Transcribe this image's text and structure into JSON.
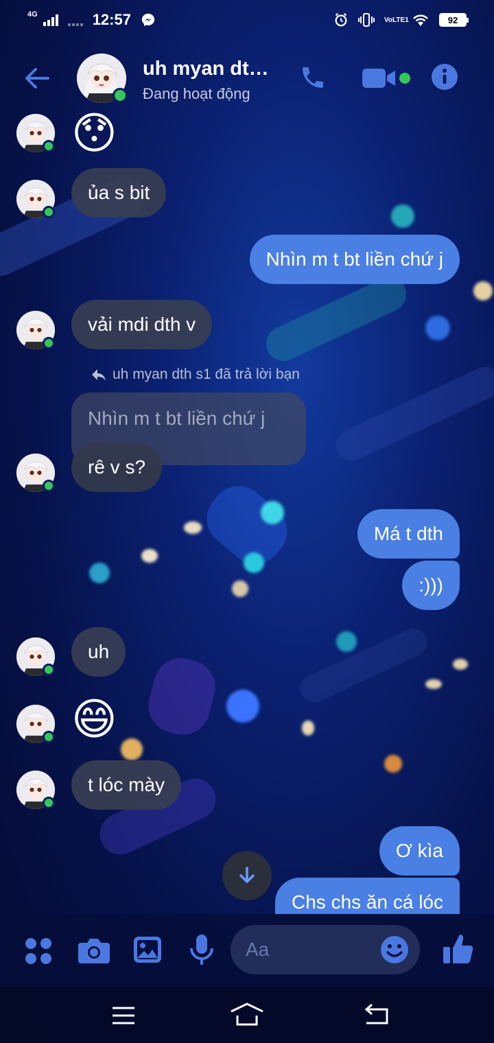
{
  "status_bar": {
    "network": "4G",
    "time": "12:57",
    "lte_label": "VoLTE1",
    "battery": "92"
  },
  "header": {
    "title": "uh myan dt…",
    "subtitle": "Đang hoạt động"
  },
  "messages": [
    {
      "side": "in",
      "type": "emoji",
      "text": "😯"
    },
    {
      "side": "in",
      "type": "text",
      "text": "ủa s bit"
    },
    {
      "side": "out",
      "type": "text",
      "text": "Nhìn m t bt liền chứ j"
    },
    {
      "side": "in",
      "type": "text",
      "text": "vải mdi dth v"
    },
    {
      "side": "in",
      "type": "reply",
      "reply_note": "uh myan dth s1 đã trả lời bạn",
      "quoted": "Nhìn m t bt liền chứ j",
      "text": "rê v s?"
    },
    {
      "side": "out",
      "type": "text",
      "text": "Má t dth"
    },
    {
      "side": "out",
      "type": "text",
      "text": ":)))"
    },
    {
      "side": "in",
      "type": "text",
      "text": "uh"
    },
    {
      "side": "in",
      "type": "emoji",
      "text": "😄"
    },
    {
      "side": "in",
      "type": "text",
      "text": "t lóc mày"
    },
    {
      "side": "out",
      "type": "text",
      "text": "Ơ kìa"
    },
    {
      "side": "out",
      "type": "text",
      "text": "Chs chs ăn cá lóc"
    }
  ],
  "composer": {
    "placeholder": "Aa"
  },
  "colors": {
    "accent": "#4a7fe3",
    "icon_blue": "#4b78e0",
    "presence": "#34c759",
    "incoming_bubble": "#373e52"
  },
  "icons": [
    "back-arrow-icon",
    "phone-icon",
    "video-camera-icon",
    "info-icon",
    "apps-icon",
    "camera-icon",
    "image-icon",
    "microphone-icon",
    "smiley-icon",
    "thumbs-up-icon",
    "arrow-down-icon",
    "reply-icon"
  ]
}
